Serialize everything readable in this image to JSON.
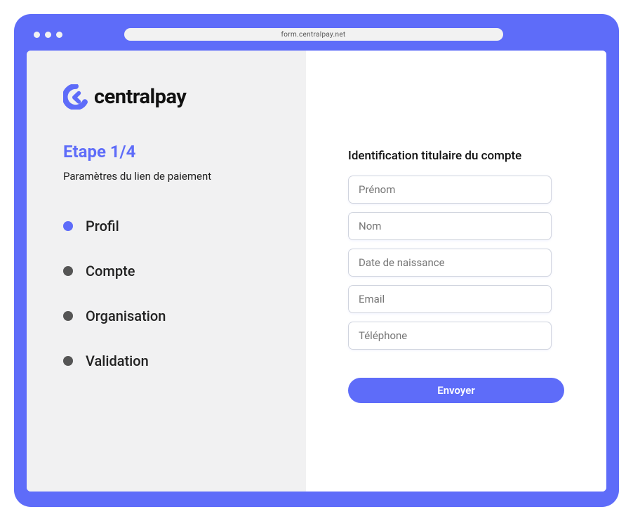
{
  "browser": {
    "url": "form.centralpay.net"
  },
  "logo": {
    "text": "centralpay"
  },
  "sidebar": {
    "step_heading": "Etape 1/4",
    "step_subtitle": "Paramètres du lien de paiement",
    "steps": [
      {
        "label": "Profil"
      },
      {
        "label": "Compte"
      },
      {
        "label": "Organisation"
      },
      {
        "label": "Validation"
      }
    ]
  },
  "form": {
    "title": "Identification titulaire du compte",
    "fields": {
      "firstname_placeholder": "Prénom",
      "lastname_placeholder": "Nom",
      "dob_placeholder": "Date de naissance",
      "email_placeholder": "Email",
      "phone_placeholder": "Téléphone"
    },
    "submit_label": "Envoyer"
  }
}
